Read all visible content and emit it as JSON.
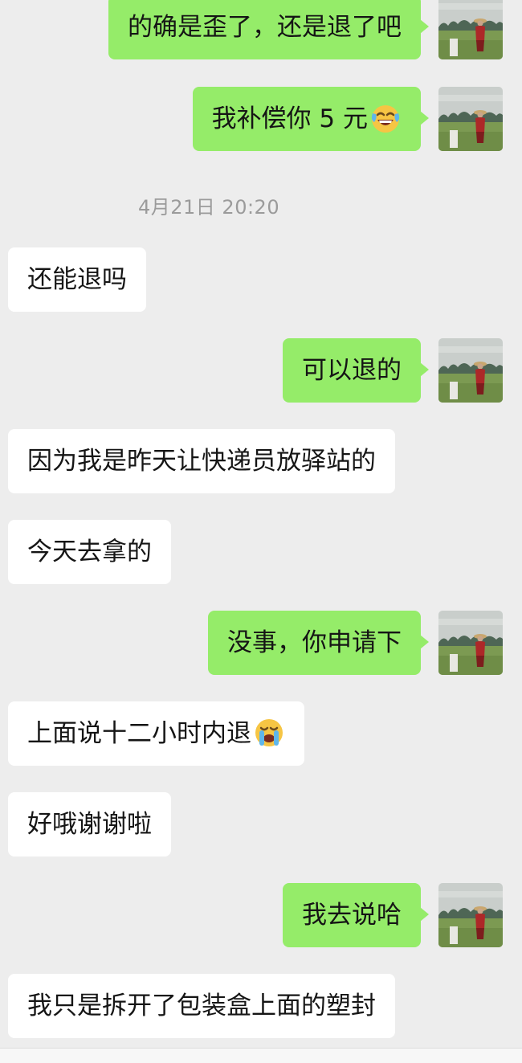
{
  "chat": {
    "timestamp": "4月21日 20:20",
    "messages": [
      {
        "id": "m1",
        "side": "out",
        "text": "的确是歪了，还是退了吧",
        "emoji": ""
      },
      {
        "id": "m2",
        "side": "out",
        "text": "我补偿你 5 元",
        "emoji": "laugh-tears-emoji"
      },
      {
        "id": "m3",
        "side": "in",
        "text": "还能退吗",
        "emoji": ""
      },
      {
        "id": "m4",
        "side": "out",
        "text": "可以退的",
        "emoji": ""
      },
      {
        "id": "m5",
        "side": "in",
        "text": "因为我是昨天让快递员放驿站的",
        "emoji": ""
      },
      {
        "id": "m6",
        "side": "in",
        "text": "今天去拿的",
        "emoji": ""
      },
      {
        "id": "m7",
        "side": "out",
        "text": "没事，你申请下",
        "emoji": ""
      },
      {
        "id": "m8",
        "side": "in",
        "text": "上面说十二小时内退",
        "emoji": "crying-emoji"
      },
      {
        "id": "m9",
        "side": "in",
        "text": "好哦谢谢啦",
        "emoji": ""
      },
      {
        "id": "m10",
        "side": "out",
        "text": "我去说哈",
        "emoji": ""
      },
      {
        "id": "m11",
        "side": "in",
        "text": "我只是拆开了包装盒上面的塑封",
        "emoji": ""
      }
    ]
  },
  "colors": {
    "background": "#ededed",
    "outgoing_bubble": "#95ec69",
    "incoming_bubble": "#ffffff",
    "timestamp_text": "#9b9b9b"
  },
  "icons": {
    "avatar": "avatar-photo-icon"
  }
}
